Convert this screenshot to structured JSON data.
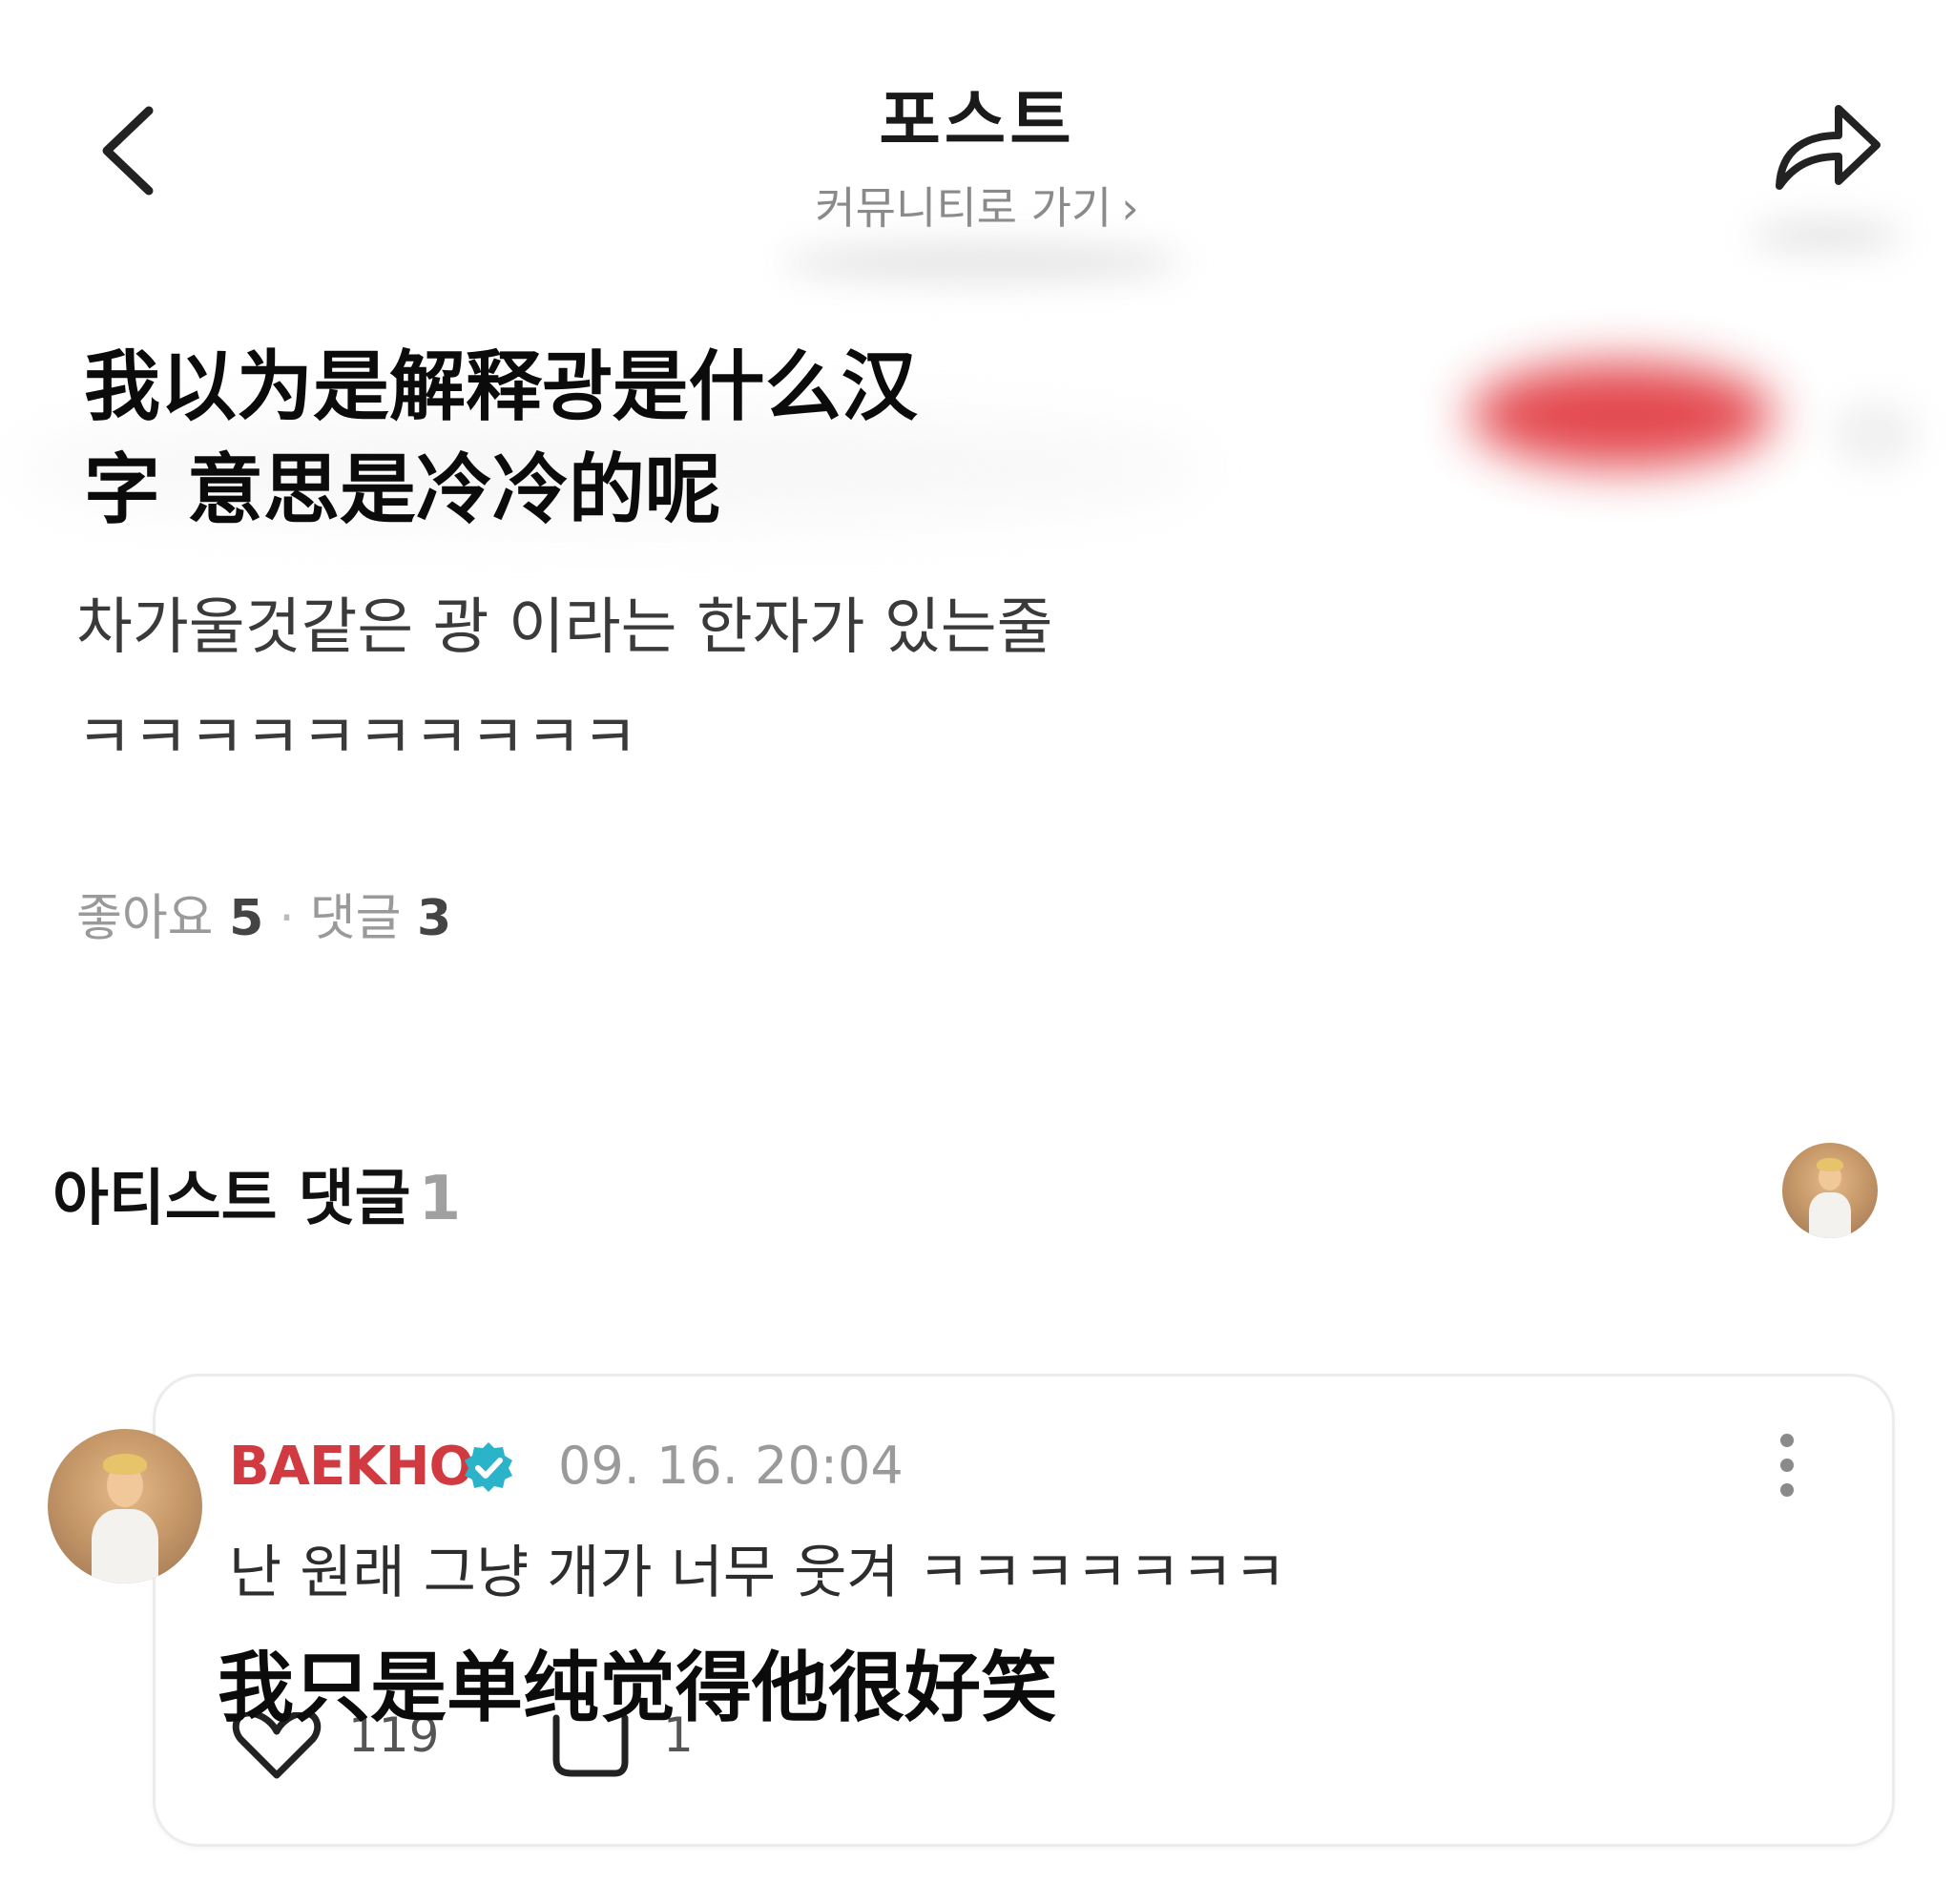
{
  "header": {
    "title": "포스트",
    "community_link": "커뮤니티로 가기",
    "back_icon": "chevron-left-icon",
    "share_icon": "share-arrow-icon"
  },
  "overlay_caption_top": [
    "我以为是解释광是什么汉",
    "字 意思是冷冷的呢"
  ],
  "post": {
    "body_lines": [
      "차가울것같은 광 이라는 한자가 있는줄",
      "ㅋㅋㅋㅋㅋㅋㅋㅋㅋㅋ"
    ],
    "likes_label": "좋아요",
    "likes_count": "5",
    "separator": "·",
    "comments_label": "댓글",
    "comments_count": "3"
  },
  "artist_comments": {
    "heading": "아티스트 댓글",
    "count": "1"
  },
  "comment": {
    "author": "BAEKHO",
    "timestamp": "09. 16. 20:04",
    "text": "난 원래 그냥 개가 너무 웃겨 ㅋㅋㅋㅋㅋㅋㅋ",
    "like_count": "119",
    "reply_count": "1"
  },
  "overlay_caption_bottom": "我只是单纯觉得他很好笑",
  "colors": {
    "author_name": "#d03a40",
    "verified_badge": "#2bb3c9",
    "muted_text": "#9a9a9a",
    "card_border": "#ececec"
  }
}
